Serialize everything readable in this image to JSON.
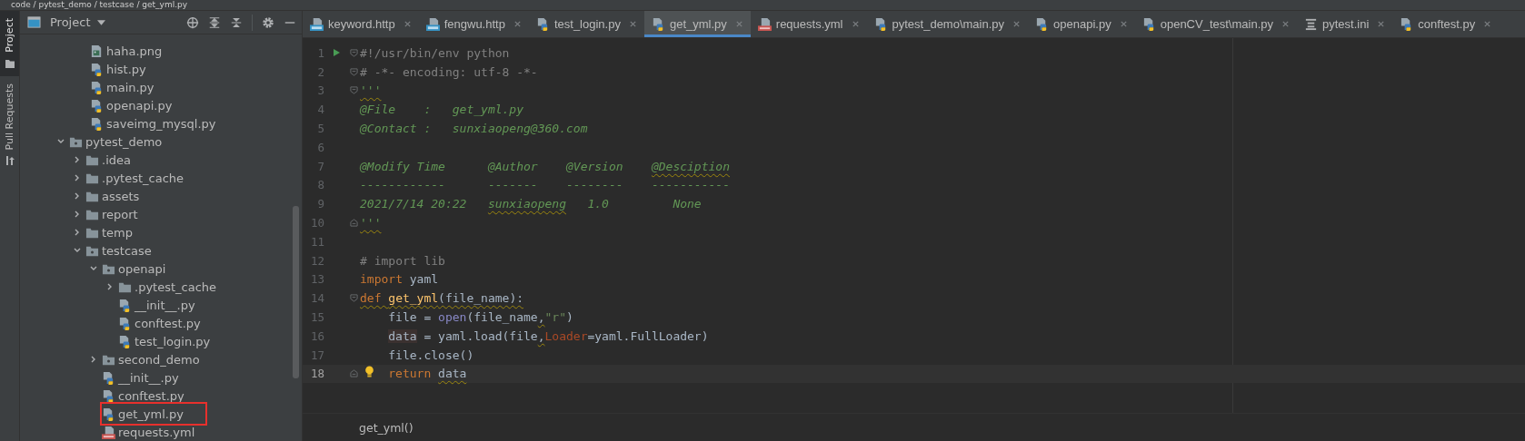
{
  "breadcrumb": "code / pytest_demo / testcase / get_yml.py",
  "side_tabs": [
    {
      "label": "Project",
      "selected": true,
      "kind": "folder"
    },
    {
      "label": "Pull Requests",
      "selected": false,
      "kind": "pull"
    }
  ],
  "project_panel": {
    "title": "Project",
    "scrolled_files": [
      {
        "name": "haha.png",
        "kind": "image",
        "highlighted": false
      },
      {
        "name": "hist.py",
        "kind": "python",
        "highlighted": false
      },
      {
        "name": "main.py",
        "kind": "python",
        "highlighted": false
      },
      {
        "name": "openapi.py",
        "kind": "python",
        "highlighted": false
      },
      {
        "name": "saveimg_mysql.py",
        "kind": "python",
        "highlighted": false
      }
    ],
    "tree": [
      {
        "name": "pytest_demo",
        "kind": "package",
        "expanded": true,
        "children": [
          {
            "name": ".idea",
            "kind": "folder",
            "expanded": false
          },
          {
            "name": ".pytest_cache",
            "kind": "folder",
            "expanded": false
          },
          {
            "name": "assets",
            "kind": "folder",
            "expanded": false
          },
          {
            "name": "report",
            "kind": "folder",
            "expanded": false
          },
          {
            "name": "temp",
            "kind": "folder",
            "expanded": false
          },
          {
            "name": "testcase",
            "kind": "package",
            "expanded": true,
            "children": [
              {
                "name": "openapi",
                "kind": "package",
                "expanded": true,
                "children": [
                  {
                    "name": ".pytest_cache",
                    "kind": "folder",
                    "expanded": false
                  },
                  {
                    "name": "__init__.py",
                    "kind": "python",
                    "highlighted": false
                  },
                  {
                    "name": "conftest.py",
                    "kind": "python",
                    "highlighted": false
                  },
                  {
                    "name": "test_login.py",
                    "kind": "python",
                    "highlighted": false
                  }
                ]
              },
              {
                "name": "second_demo",
                "kind": "package",
                "expanded": false
              },
              {
                "name": "__init__.py",
                "kind": "python",
                "highlighted": false
              },
              {
                "name": "conftest.py",
                "kind": "python",
                "highlighted": false
              },
              {
                "name": "get_yml.py",
                "kind": "python",
                "highlighted": true
              },
              {
                "name": "requests.yml",
                "kind": "yaml",
                "highlighted": false
              }
            ]
          }
        ]
      }
    ]
  },
  "tabs": [
    {
      "label": "keyword.http",
      "kind": "api",
      "selected": false
    },
    {
      "label": "fengwu.http",
      "kind": "api",
      "selected": false
    },
    {
      "label": "test_login.py",
      "kind": "python",
      "selected": false
    },
    {
      "label": "get_yml.py",
      "kind": "python",
      "selected": true
    },
    {
      "label": "requests.yml",
      "kind": "yaml",
      "selected": false
    },
    {
      "label": "pytest_demo\\main.py",
      "kind": "python",
      "selected": false
    },
    {
      "label": "openapi.py",
      "kind": "python",
      "selected": false
    },
    {
      "label": "openCV_test\\main.py",
      "kind": "python",
      "selected": false
    },
    {
      "label": "pytest.ini",
      "kind": "ini",
      "selected": false
    },
    {
      "label": "conftest.py",
      "kind": "python",
      "selected": false
    }
  ],
  "code_lines": [
    {
      "number": "1",
      "current": false,
      "run": true,
      "fold_start": true,
      "tokens": [
        {
          "text": "#!/usr/bin/env python",
          "kind": "comment"
        }
      ]
    },
    {
      "number": "2",
      "current": false,
      "fold_start": true,
      "tokens": [
        {
          "text": "# -*- encoding: utf-8 -*-",
          "kind": "comment"
        }
      ]
    },
    {
      "number": "3",
      "current": false,
      "fold_start": true,
      "tokens": [
        {
          "text": "'''",
          "kind": "doc",
          "wavy": true
        }
      ]
    },
    {
      "number": "4",
      "current": false,
      "tokens": [
        {
          "text": "@File    :   get_yml.py",
          "kind": "doc"
        }
      ]
    },
    {
      "number": "5",
      "current": false,
      "tokens": [
        {
          "text": "@Contact :   sunxiaopeng@360.com",
          "kind": "doc"
        }
      ]
    },
    {
      "number": "6",
      "current": false
    },
    {
      "number": "7",
      "current": false,
      "tokens": [
        {
          "text": "@Modify Time      @Author    @Version    ",
          "kind": "doc"
        },
        {
          "text": "@Desciption",
          "kind": "doc",
          "wavy": true
        }
      ]
    },
    {
      "number": "8",
      "current": false,
      "tokens": [
        {
          "text": "------------      -------    --------    -----------",
          "kind": "doc"
        }
      ]
    },
    {
      "number": "9",
      "current": false,
      "tokens": [
        {
          "text": "2021/7/14 20:22   ",
          "kind": "doc"
        },
        {
          "text": "sunxiaopeng",
          "kind": "doc",
          "wavy": true
        },
        {
          "text": "   1.0         None",
          "kind": "doc"
        }
      ]
    },
    {
      "number": "10",
      "current": false,
      "fold_end": true,
      "tokens": [
        {
          "text": "'''",
          "kind": "doc",
          "wavy": true
        }
      ]
    },
    {
      "number": "11",
      "current": false
    },
    {
      "number": "12",
      "current": false,
      "tokens": [
        {
          "text": "# import lib",
          "kind": "comment"
        }
      ]
    },
    {
      "number": "13",
      "current": false,
      "tokens": [
        {
          "text": "import",
          "kind": "keyword"
        },
        {
          "text": " yaml",
          "kind": "plain"
        }
      ]
    },
    {
      "number": "14",
      "current": false,
      "fold_start": true,
      "tokens": [
        {
          "text": "def ",
          "kind": "keyword",
          "wavy": true
        },
        {
          "text": "get_yml",
          "kind": "func",
          "wavy": true
        },
        {
          "text": "(file_name):",
          "kind": "plain",
          "wavy": true
        }
      ]
    },
    {
      "number": "15",
      "current": false,
      "indented": true,
      "tokens": [
        {
          "text": "file = ",
          "kind": "plain"
        },
        {
          "text": "open",
          "kind": "builtin"
        },
        {
          "text": "(file_name",
          "kind": "plain"
        },
        {
          "text": ",",
          "kind": "plain",
          "wavy": true
        },
        {
          "text": "\"r\"",
          "kind": "string"
        },
        {
          "text": ")",
          "kind": "plain"
        }
      ]
    },
    {
      "number": "16",
      "current": false,
      "indented": true,
      "tokens": [
        {
          "text": "data",
          "kind": "local"
        },
        {
          "text": " = yaml.load(file",
          "kind": "plain"
        },
        {
          "text": ",",
          "kind": "plain",
          "wavy": true
        },
        {
          "text": "Loader",
          "kind": "param"
        },
        {
          "text": "=yaml.FullLoader)",
          "kind": "plain"
        }
      ]
    },
    {
      "number": "17",
      "current": false,
      "indented": true,
      "tokens": [
        {
          "text": "file.close()",
          "kind": "plain"
        }
      ]
    },
    {
      "number": "18",
      "current": true,
      "hint": true,
      "fold_end": true,
      "indented": true,
      "tokens": [
        {
          "text": "return ",
          "kind": "keyword"
        },
        {
          "text": "data",
          "kind": "plain",
          "wavy": true
        }
      ]
    }
  ],
  "editor_breadcrumb": "get_yml()"
}
